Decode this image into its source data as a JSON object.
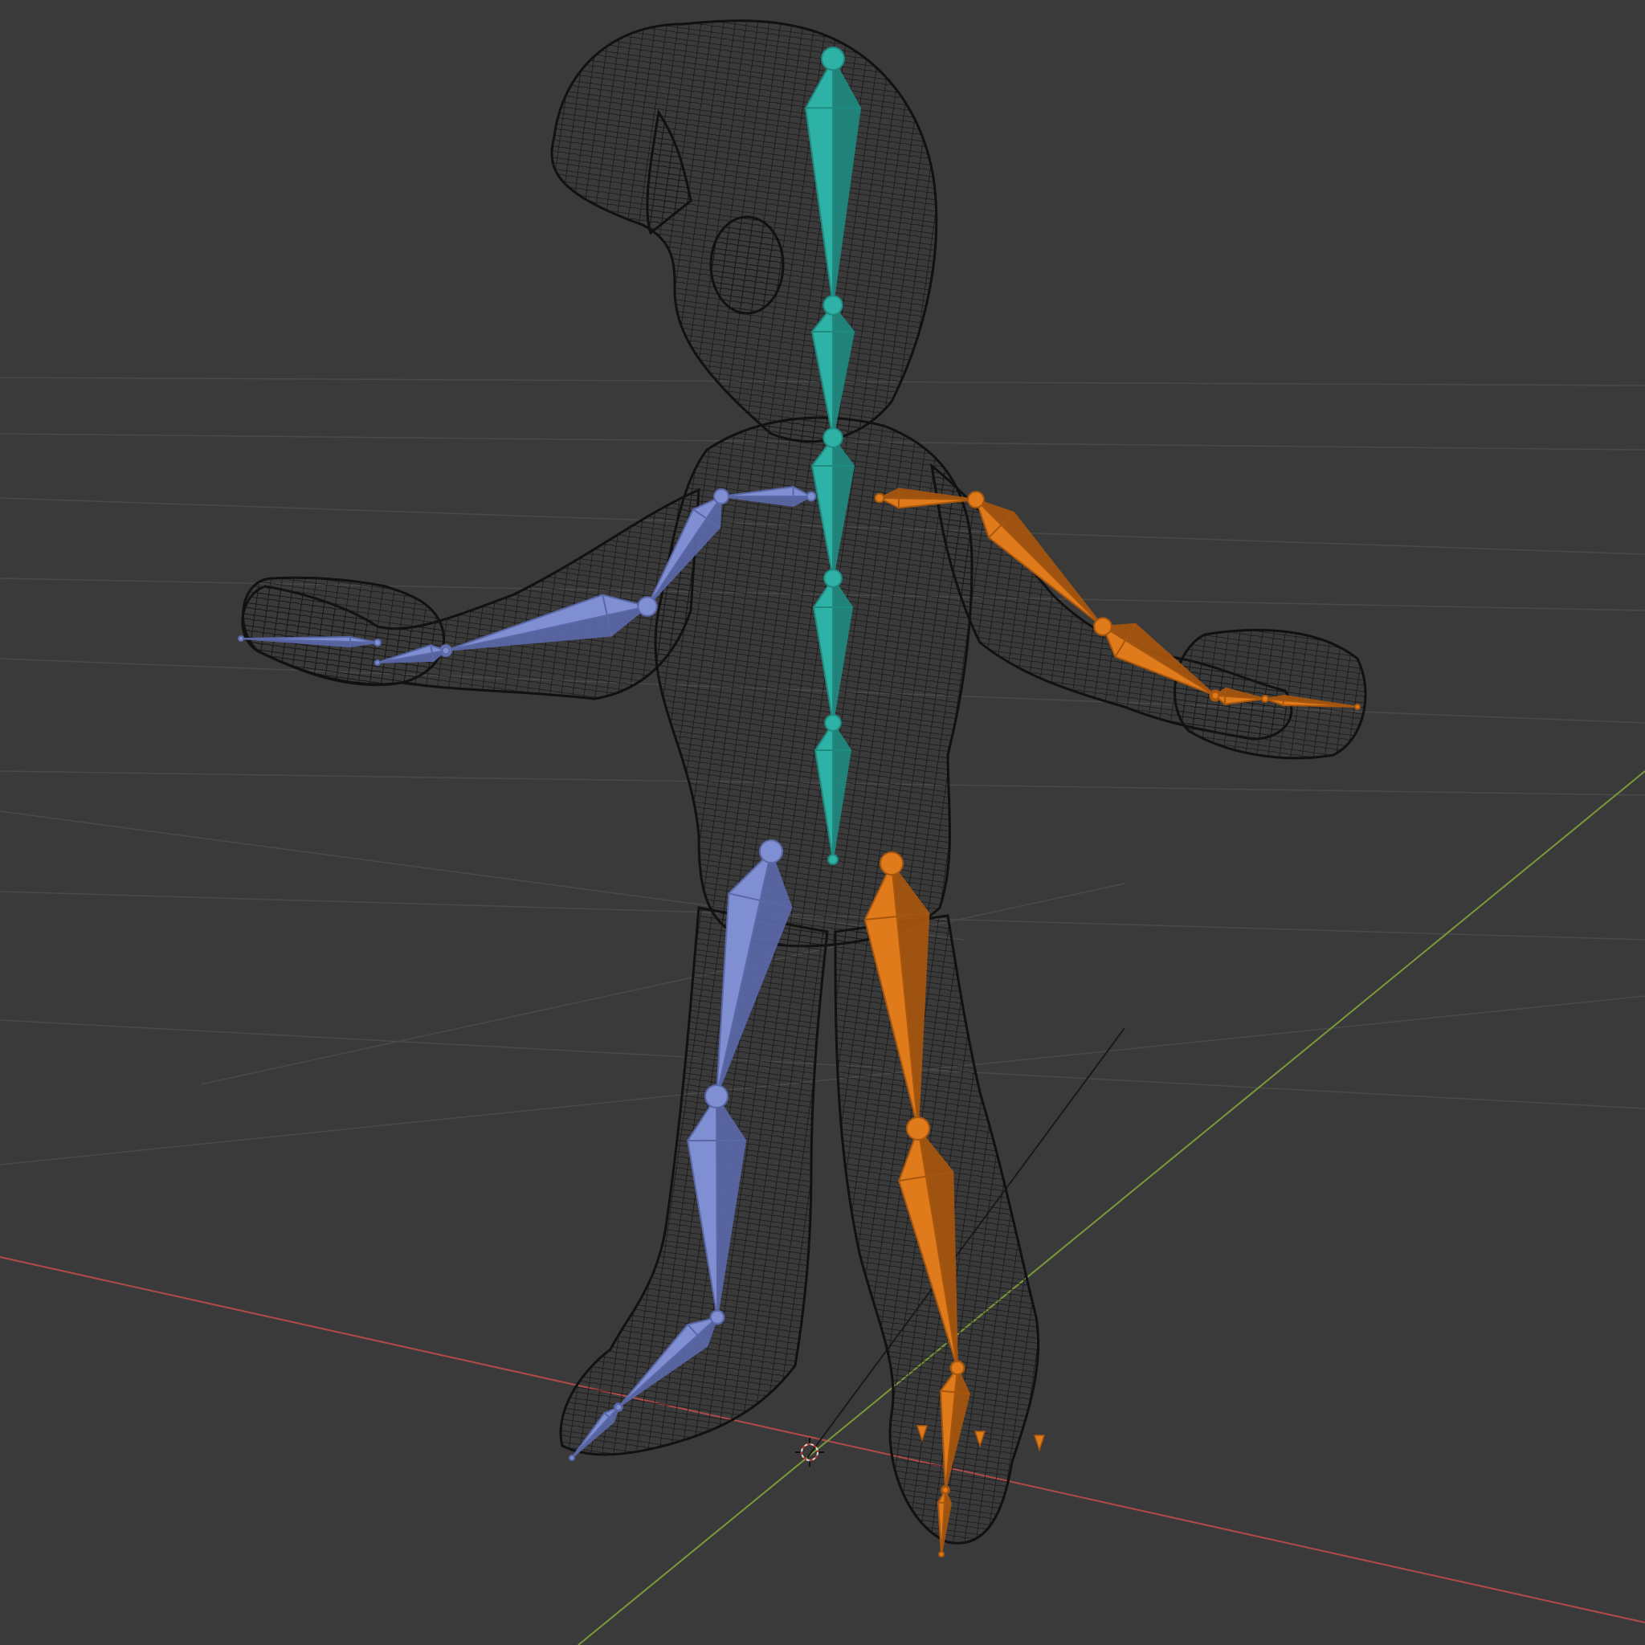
{
  "viewport": {
    "background": "#3a3a3a",
    "grid_color": "#4a4a4a",
    "axis_x_color": "#b34a4a",
    "axis_y_color": "#7a9a3a"
  },
  "bone_colors": {
    "spine": "#2eb2a6",
    "spine_dark": "#1f8a80",
    "right_side": "#7f8fd1",
    "right_side_dark": "#5a68a8",
    "left_side": "#e07b1c",
    "left_side_dark": "#a8560e"
  },
  "mesh": {
    "style": "wireframe",
    "color": "#111111"
  },
  "armature": {
    "name": "armature",
    "bone_groups": [
      "spine",
      "right_side",
      "left_side"
    ]
  }
}
